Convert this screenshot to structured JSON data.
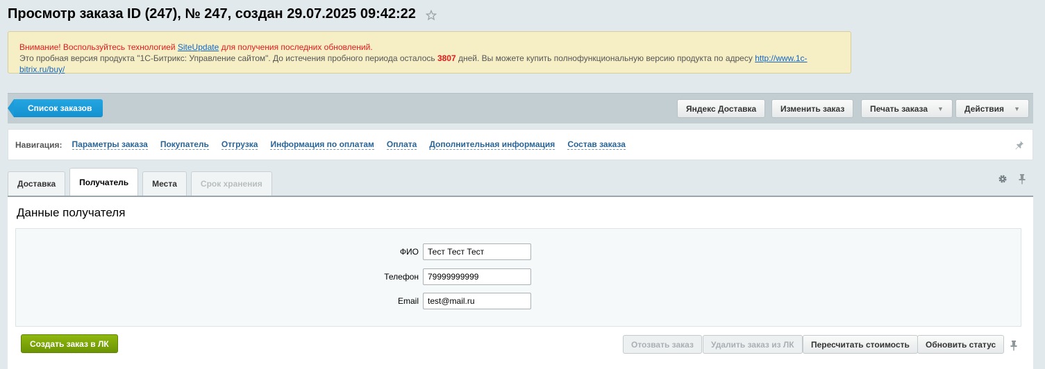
{
  "header": {
    "title": "Просмотр заказа ID (247), № 247, создан 29.07.2025 09:42:22",
    "star_icon": "star-icon"
  },
  "notice": {
    "line1_before": "Внимание! Воспользуйтесь технологией ",
    "line1_link": "SiteUpdate",
    "line1_after": " для получения последних обновлений.",
    "line2_before": "Это пробная версия продукта \"1С-Битрикс: Управление сайтом\". До истечения пробного периода осталось ",
    "line2_days": "3807",
    "line2_middle": " дней. Вы можете купить полнофункциональную версию продукта по адресу ",
    "line2_link": "http://www.1c-bitrix.ru/buy/"
  },
  "toolbar": {
    "back_label": "Список заказов",
    "yandex_label": "Яндекс Доставка",
    "edit_label": "Изменить заказ",
    "print_label": "Печать заказа",
    "actions_label": "Действия"
  },
  "navigation": {
    "label": "Навигация:",
    "links": [
      "Параметры заказа",
      "Покупатель",
      "Отгрузка",
      "Информация по оплатам",
      "Оплата",
      "Дополнительная информация",
      "Состав заказа"
    ]
  },
  "tabs": [
    "Доставка",
    "Получатель",
    "Места",
    "Срок хранения"
  ],
  "recipient": {
    "title": "Данные получателя",
    "fio_label": "ФИО",
    "fio_value": "Тест Тест Тест",
    "phone_label": "Телефон",
    "phone_value": "79999999999",
    "email_label": "Email",
    "email_value": "test@mail.ru"
  },
  "actions": {
    "create_label": "Создать заказ в ЛК",
    "recall_label": "Отозвать заказ",
    "delete_label": "Удалить заказ из ЛК",
    "recalc_label": "Пересчитать стоимость",
    "update_label": "Обновить статус"
  },
  "colors": {
    "accent_blue": "#1590cf",
    "accent_green": "#6c9403",
    "notice_bg": "#f6efc6",
    "warning_red": "#e11a1a"
  }
}
